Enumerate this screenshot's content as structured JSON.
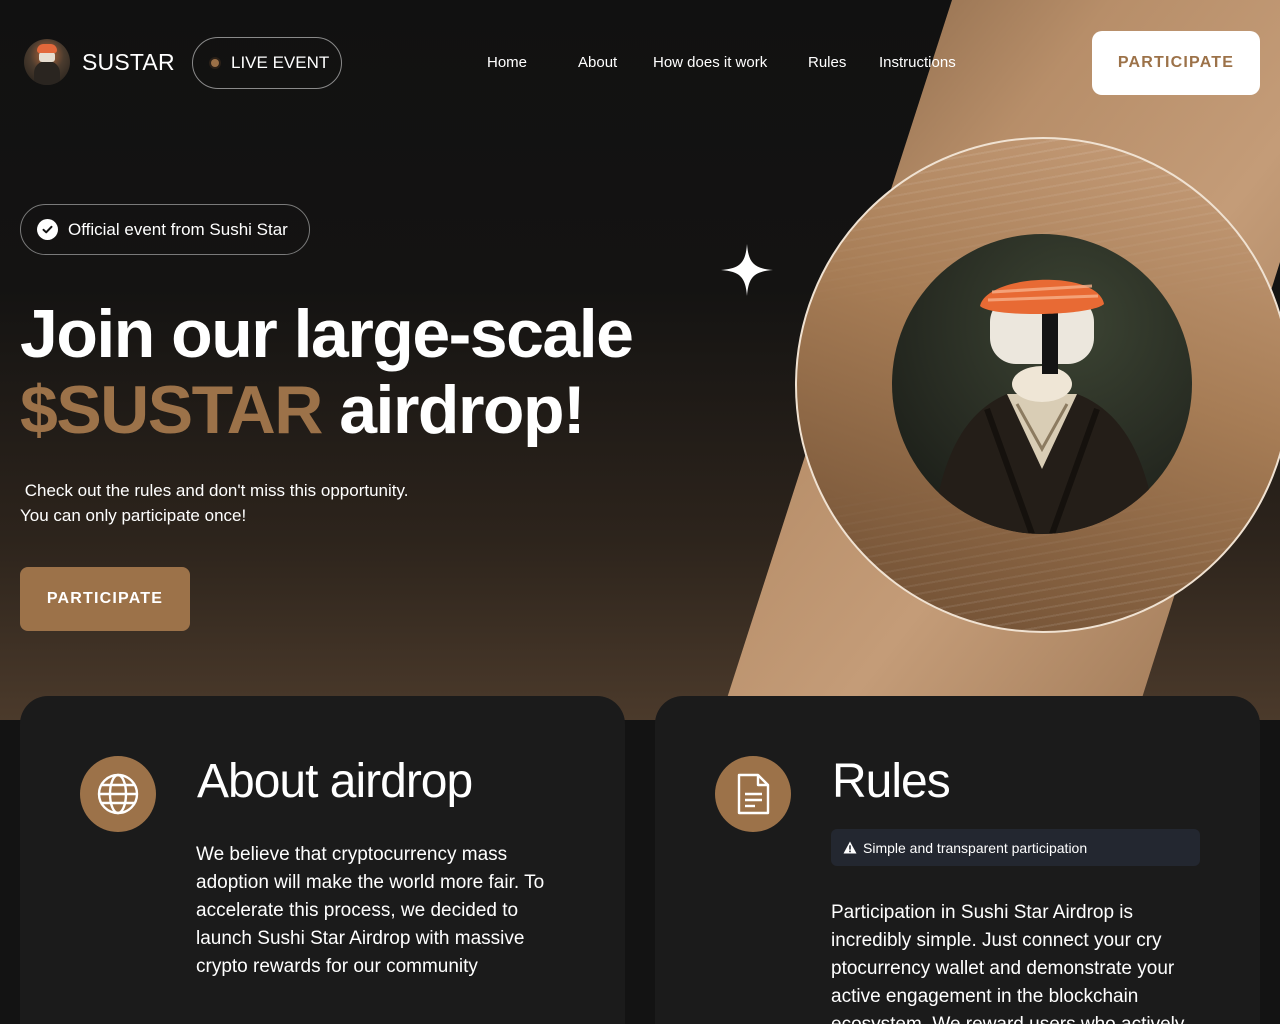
{
  "header": {
    "logo_text": "SUSTAR",
    "live_label": "LIVE EVENT",
    "nav": [
      "Home",
      "About",
      "How does it work",
      "Rules",
      "Instructions"
    ],
    "cta_label": "PARTICIPATE"
  },
  "hero": {
    "badge_label": "Official event from Sushi Star",
    "headline_line1": "Join our large-scale",
    "headline_accent": "$SUSTAR",
    "headline_rest": " airdrop!",
    "sub_line1": " Check out the rules and don't miss this opportunity.",
    "sub_line2": "You can only participate once!",
    "cta_label": "PARTICIPATE"
  },
  "about": {
    "title": "About airdrop",
    "icon": "globe-icon",
    "body": "We believe that cryptocurrency mass adoption will make the world more fair. To accelerate this process, we decided to launch Sushi Star Airdrop with massive crypto rewards for our community"
  },
  "rules": {
    "title": "Rules",
    "icon": "document-icon",
    "notice": "Simple and transparent participation",
    "body": "Participation in Sushi Star Airdrop is incredibly simple. Just connect your cry ptocurrency wallet and demonstrate your active engagement in the blockchain ecosystem. We reward users who actively"
  },
  "colors": {
    "accent": "#9c7249",
    "background": "#131313",
    "card": "#1b1b1b"
  }
}
